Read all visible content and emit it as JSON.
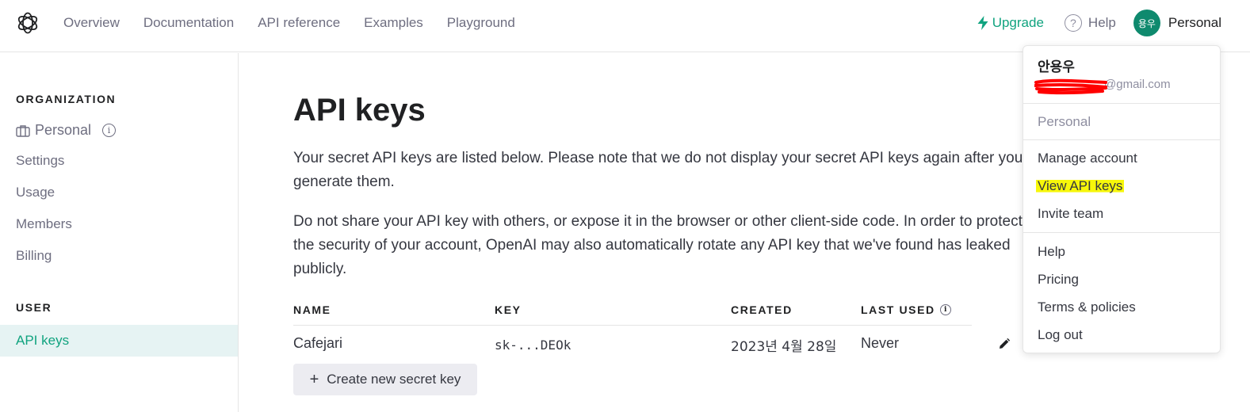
{
  "nav": {
    "items": [
      "Overview",
      "Documentation",
      "API reference",
      "Examples",
      "Playground"
    ],
    "upgrade": "Upgrade",
    "help": "Help",
    "avatar_initials": "용우",
    "account_label": "Personal",
    "accent_color": "#10a37f"
  },
  "sidebar": {
    "organization_heading": "ORGANIZATION",
    "org_name": "Personal",
    "items": [
      "Settings",
      "Usage",
      "Members",
      "Billing"
    ],
    "user_heading": "USER",
    "active_item": "API keys"
  },
  "main": {
    "title": "API keys",
    "para1": "Your secret API keys are listed below. Please note that we do not display your secret API keys again after you generate them.",
    "para2": "Do not share your API key with others, or expose it in the browser or other client-side code. In order to protect the security of your account, OpenAI may also automatically rotate any API key that we've found has leaked publicly.",
    "table": {
      "headers": [
        "NAME",
        "KEY",
        "CREATED",
        "LAST USED"
      ],
      "rows": [
        {
          "name": "Cafejari",
          "key": "sk-...DEOk",
          "created": "2023년 4월 28일",
          "last_used": "Never"
        }
      ]
    },
    "create_button": "Create new secret key"
  },
  "dropdown": {
    "user_name": "안용우",
    "email_visible": "@gmail.com",
    "org": "Personal",
    "items_group1": [
      "Manage account",
      "View API keys",
      "Invite team"
    ],
    "items_group2": [
      "Help",
      "Pricing",
      "Terms & policies",
      "Log out"
    ],
    "highlight_color": "#f7f70a",
    "redaction_color": "#ff0000"
  }
}
